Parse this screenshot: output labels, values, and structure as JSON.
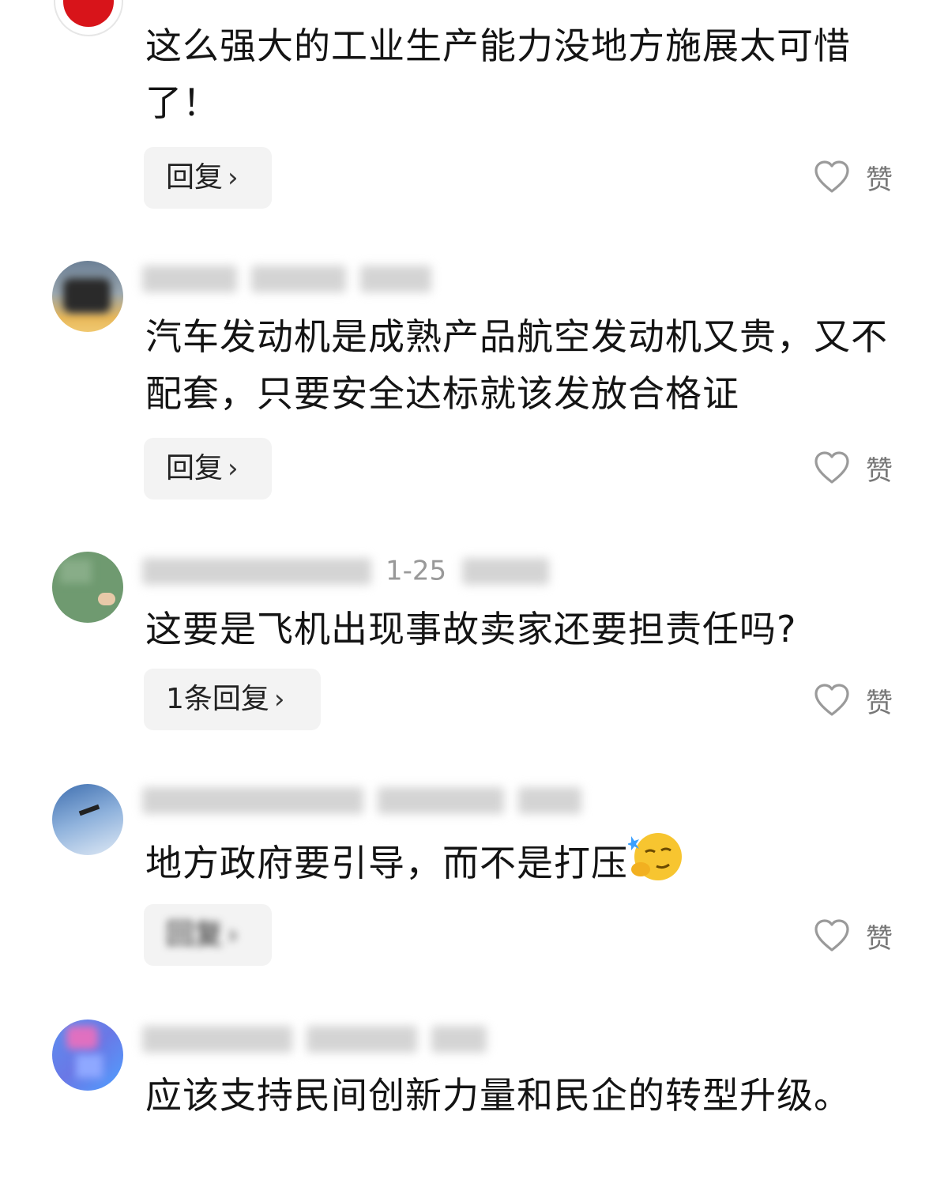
{
  "comments": [
    {
      "text": "这么强大的工业生产能力没地方施展太可惜了！",
      "reply_label": "回复",
      "like_label": "赞"
    },
    {
      "text": "汽车发动机是成熟产品航空发动机又贵，又不配套，只要安全达标就该发放合格证",
      "reply_label": "回复",
      "like_label": "赞"
    },
    {
      "meta_visible": "1-25",
      "text": "这要是飞机出现事故卖家还要担责任吗?",
      "reply_label": "1条回复",
      "like_label": "赞"
    },
    {
      "text": "地方政府要引导，而不是打压",
      "emoji": "smirk-thinking-emoji",
      "reply_label": "回复",
      "like_label": "赞"
    },
    {
      "text": "应该支持民间创新力量和民企的转型升级。"
    }
  ],
  "icons": {
    "like": "heart-outline-icon",
    "reply_arrow": "chevron-right-icon"
  },
  "colors": {
    "text": "#141414",
    "button_bg": "#f3f3f3",
    "like_gray": "#777777"
  }
}
